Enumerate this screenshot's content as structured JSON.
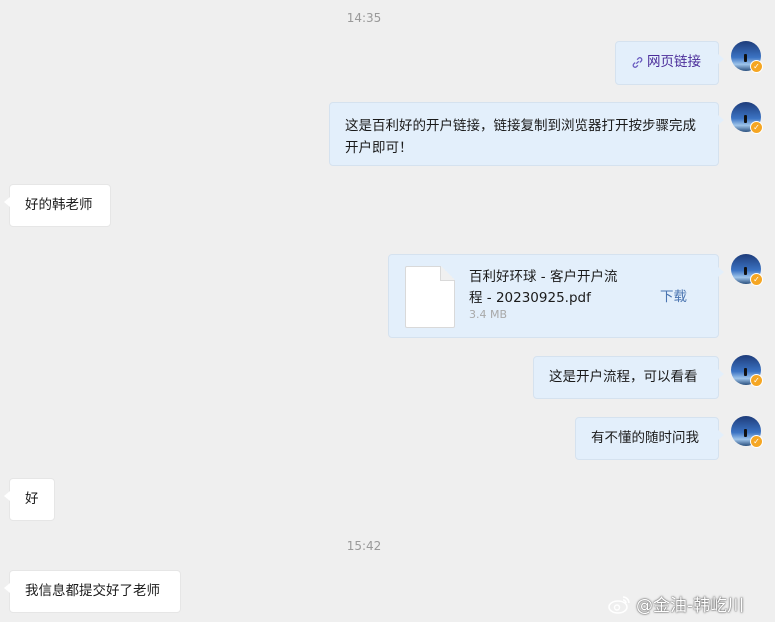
{
  "timestamps": [
    "14:35",
    "15:42"
  ],
  "messages": {
    "link": "网页链接",
    "link_intro": "这是百利好的开户链接，链接复制到浏览器打开按步骤完成开户即可！",
    "reply_1": "好的韩老师",
    "file": {
      "name": "百利好环球 - 客户开户流程 - 20230925.pdf",
      "size": "3.4 MB",
      "download": "下载"
    },
    "process_note": "这是开户流程，可以看看",
    "ask_anytime": "有不懂的随时问我",
    "reply_2": "好",
    "reply_3": "我信息都提交好了老师"
  },
  "watermark": "@金油-韩屹川",
  "icons": {
    "link": "link-icon",
    "avatar_badge": "verified-badge-icon",
    "watermark": "weibo-logo-icon"
  }
}
